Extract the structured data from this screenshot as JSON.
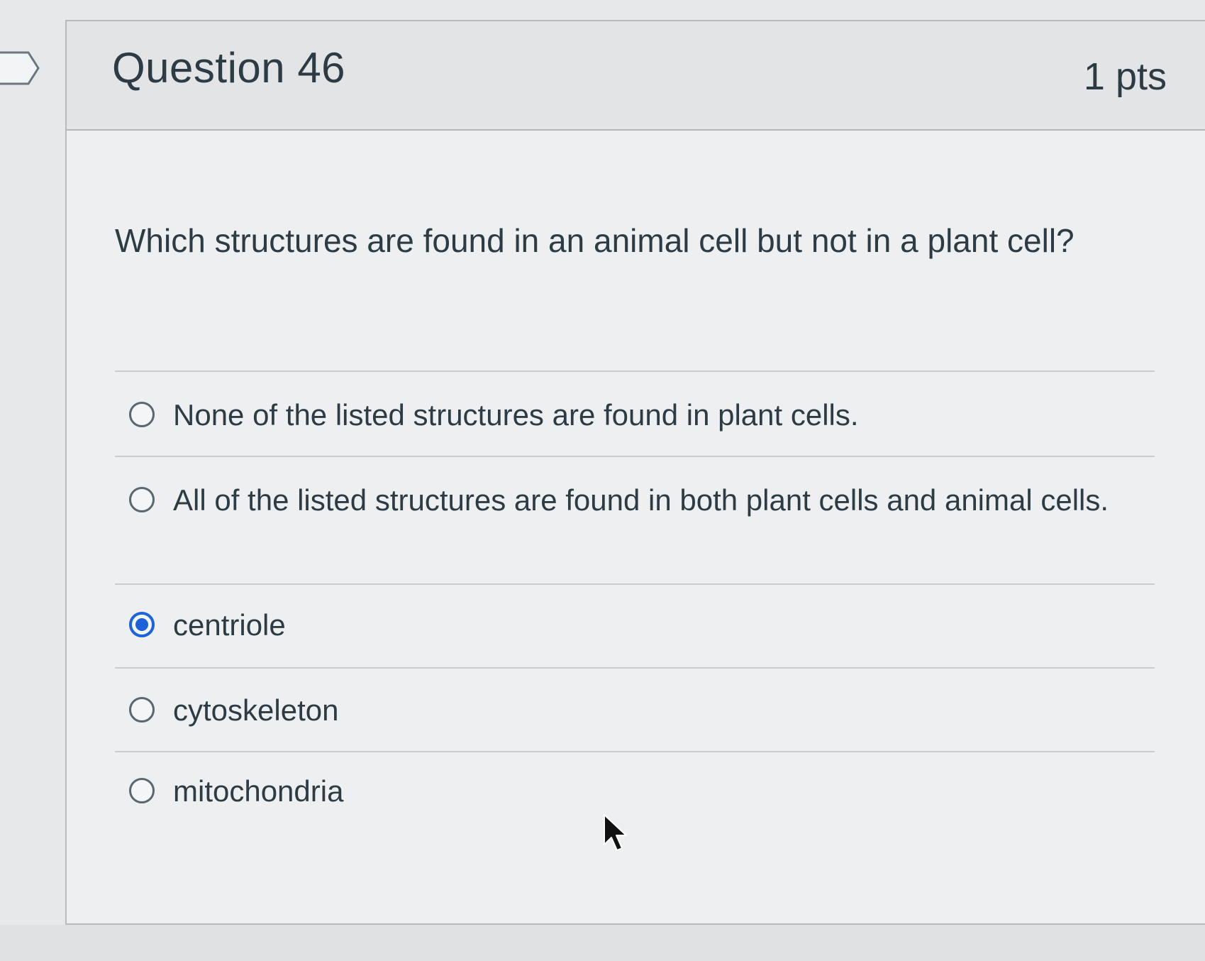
{
  "question": {
    "title": "Question 46",
    "points": "1 pts",
    "text": "Which structures are found in an animal cell but not in a plant cell?"
  },
  "answers": [
    {
      "label": "None of the listed structures are found in plant cells.",
      "selected": false
    },
    {
      "label": "All of the listed structures are found in both plant cells and animal cells.",
      "selected": false
    },
    {
      "label": "centriole",
      "selected": true
    },
    {
      "label": "cytoskeleton",
      "selected": false
    },
    {
      "label": "mitochondria",
      "selected": false
    }
  ],
  "colors": {
    "accent": "#1c63d9",
    "text": "#2d3b45",
    "background": "#edeff0"
  },
  "icons": {
    "flag": "question-flag-icon",
    "cursor": "mouse-pointer-icon"
  }
}
